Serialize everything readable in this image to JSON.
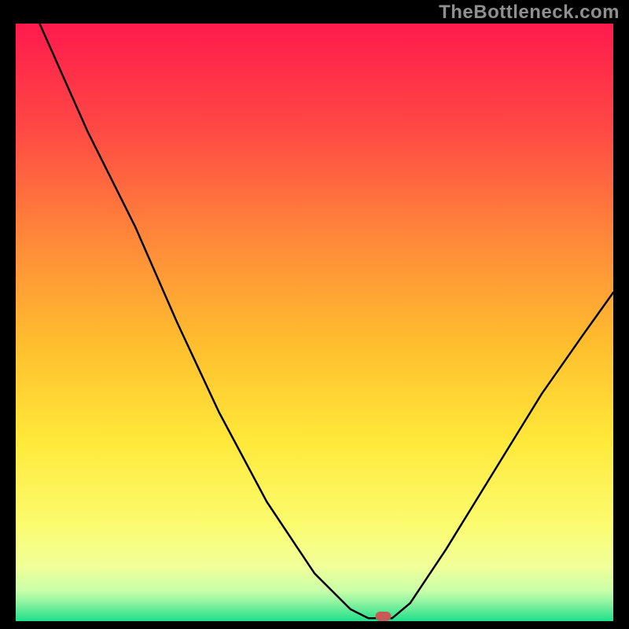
{
  "watermark": "TheBottleneck.com",
  "chart_data": {
    "type": "line",
    "title": "",
    "xlabel": "",
    "ylabel": "",
    "xlim": [
      0,
      100
    ],
    "ylim": [
      0,
      100
    ],
    "grid": false,
    "legend": false,
    "background_gradient": [
      "#ff1a4d",
      "#ff6a3c",
      "#ffbf2e",
      "#ffe93a",
      "#fdfd86",
      "#c7ffa8",
      "#1fe08b"
    ],
    "curve": {
      "name": "bottleneck-curve",
      "color": "#000000",
      "points": [
        {
          "x": 4,
          "y": 100
        },
        {
          "x": 12,
          "y": 82
        },
        {
          "x": 20,
          "y": 66
        },
        {
          "x": 27,
          "y": 50
        },
        {
          "x": 34,
          "y": 35
        },
        {
          "x": 42,
          "y": 20
        },
        {
          "x": 50,
          "y": 8
        },
        {
          "x": 56,
          "y": 2
        },
        {
          "x": 59,
          "y": 0.5
        },
        {
          "x": 63,
          "y": 0.5
        },
        {
          "x": 66,
          "y": 3
        },
        {
          "x": 72,
          "y": 12
        },
        {
          "x": 80,
          "y": 25
        },
        {
          "x": 88,
          "y": 38
        },
        {
          "x": 95,
          "y": 48
        },
        {
          "x": 100,
          "y": 55
        }
      ]
    },
    "marker": {
      "name": "optimum-point",
      "x": 61.5,
      "y": 0.8,
      "color": "#c65a57"
    }
  }
}
